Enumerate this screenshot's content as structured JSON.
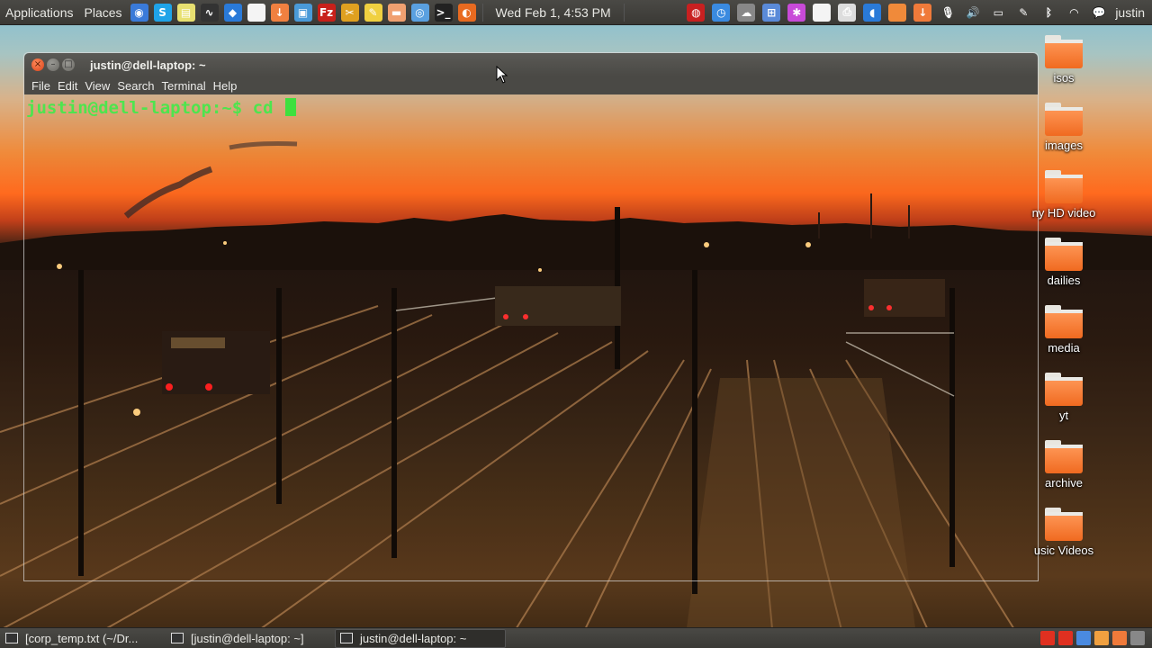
{
  "top_panel": {
    "applications_label": "Applications",
    "places_label": "Places",
    "launcher_icons": [
      {
        "name": "chrome-icon",
        "color": "#3a7ad8",
        "glyph": "◉"
      },
      {
        "name": "skype-icon",
        "color": "#1fa3e8",
        "glyph": "S"
      },
      {
        "name": "notes-icon",
        "color": "#e8e070",
        "glyph": "▤"
      },
      {
        "name": "system-monitor-icon",
        "color": "#333333",
        "glyph": "∿"
      },
      {
        "name": "dropbox-icon",
        "color": "#2a7ad8",
        "glyph": "◆"
      },
      {
        "name": "text-editor-icon",
        "color": "#f4f4f4",
        "glyph": ""
      },
      {
        "name": "download-folder-icon",
        "color": "#f08040",
        "glyph": "↓"
      },
      {
        "name": "screenshot-icon",
        "color": "#4a9ad8",
        "glyph": "▣"
      },
      {
        "name": "filezilla-icon",
        "color": "#c8201a",
        "glyph": "Fz"
      },
      {
        "name": "tools-icon",
        "color": "#e0a020",
        "glyph": "✂"
      },
      {
        "name": "sticky-notes-icon",
        "color": "#f0d040",
        "glyph": "✎"
      },
      {
        "name": "files-icon",
        "color": "#f0a070",
        "glyph": "▬"
      },
      {
        "name": "browser-icon",
        "color": "#5aa0e0",
        "glyph": "◎"
      },
      {
        "name": "terminal-icon",
        "color": "#222222",
        "glyph": ">_"
      },
      {
        "name": "firefox-icon",
        "color": "#e86a20",
        "glyph": "◐"
      }
    ],
    "clock": "Wed Feb  1,  4:53 PM",
    "tray_icons": [
      {
        "name": "redshift-icon",
        "color": "#c82020",
        "glyph": "◍"
      },
      {
        "name": "clock-icon",
        "color": "#3a8ae0",
        "glyph": "◷"
      },
      {
        "name": "weather-icon",
        "color": "#888888",
        "glyph": "☁"
      },
      {
        "name": "network-manager-icon",
        "color": "#5a8ad8",
        "glyph": "⊞"
      },
      {
        "name": "settings-icon",
        "color": "#c84ad8",
        "glyph": "✱"
      },
      {
        "name": "document-icon",
        "color": "#f4f4f4",
        "glyph": ""
      },
      {
        "name": "printer-icon",
        "color": "#dddddd",
        "glyph": "⎙"
      },
      {
        "name": "bluetooth-manager-icon",
        "color": "#2a7ad8",
        "glyph": "◖"
      },
      {
        "name": "folder-icon",
        "color": "#f08a3a",
        "glyph": ""
      },
      {
        "name": "updates-icon",
        "color": "#f07a3a",
        "glyph": "↓"
      },
      {
        "name": "microphone-icon",
        "color": "#555555",
        "glyph": "🎙"
      },
      {
        "name": "volume-icon",
        "color": "#555555",
        "glyph": "🔊"
      },
      {
        "name": "battery-icon",
        "color": "#555555",
        "glyph": "▭"
      },
      {
        "name": "edit-icon",
        "color": "#555555",
        "glyph": "✎"
      },
      {
        "name": "bluetooth-icon",
        "color": "#555555",
        "glyph": "ᛒ"
      },
      {
        "name": "wifi-icon",
        "color": "#555555",
        "glyph": "◠"
      },
      {
        "name": "chat-icon",
        "color": "#555555",
        "glyph": "💬"
      }
    ],
    "user_label": "justin"
  },
  "desktop_icons": [
    {
      "label": "isos"
    },
    {
      "label": "images"
    },
    {
      "label": "ny HD video"
    },
    {
      "label": "dailies"
    },
    {
      "label": "media"
    },
    {
      "label": "yt"
    },
    {
      "label": "archive"
    },
    {
      "label": "usic Videos"
    }
  ],
  "terminal": {
    "title": "justin@dell-laptop: ~",
    "menu": [
      "File",
      "Edit",
      "View",
      "Search",
      "Terminal",
      "Help"
    ],
    "prompt": "justin@dell-laptop:~$ cd "
  },
  "taskbar": {
    "tasks": [
      {
        "label": "[corp_temp.txt (~/Dr..."
      },
      {
        "label": "[justin@dell-laptop: ~]"
      },
      {
        "label": "justin@dell-laptop: ~"
      }
    ],
    "tray_colors": [
      "#e03020",
      "#e03020",
      "#4a8ae0",
      "#f0a040",
      "#f07a3a",
      "#888888"
    ]
  }
}
